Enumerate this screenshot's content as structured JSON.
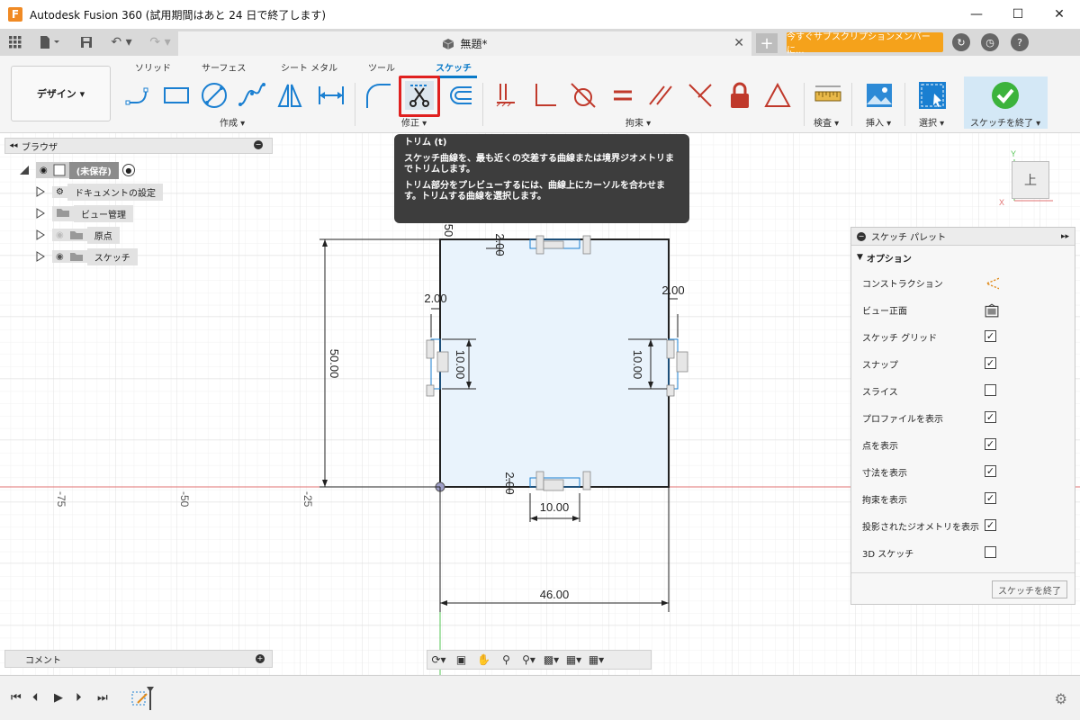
{
  "window": {
    "title": "Autodesk Fusion 360 (試用期間はあと 24 日で終了します)",
    "app_icon_letter": "F"
  },
  "tabs": {
    "document_tab": "無題*",
    "promo": "今すぐサブスクリプションメンバーに..."
  },
  "workspace": {
    "label": "デザイン ▾"
  },
  "ribbon_tabs": [
    "ソリッド",
    "サーフェス",
    "シート メタル",
    "ツール",
    "スケッチ"
  ],
  "active_tab": "スケッチ",
  "ribbon_groups": {
    "create": "作成 ▾",
    "modify": "修正 ▾",
    "constraints": "拘束 ▾",
    "inspect": "検査 ▾",
    "insert": "挿入 ▾",
    "select": "選択 ▾",
    "finish": "スケッチを終了 ▾"
  },
  "browser": {
    "title": "ブラウザ",
    "root": "(未保存)",
    "items": [
      "ドキュメントの設定",
      "ビュー管理",
      "原点",
      "スケッチ"
    ]
  },
  "tooltip": {
    "title": "トリム (t)",
    "line1": "スケッチ曲線を、最も近くの交差する曲線または境界ジオメトリまでトリムします。",
    "line2": "トリム部分をプレビューするには、曲線上にカーソルを合わせます。トリムする曲線を選択します。"
  },
  "viewcube": {
    "face": "上",
    "axis_x": "X",
    "axis_y": "Y"
  },
  "palette": {
    "title": "スケッチ パレット",
    "section": "オプション",
    "options": [
      {
        "label": "コンストラクション",
        "type": "icon"
      },
      {
        "label": "ビュー正面",
        "type": "icon"
      },
      {
        "label": "スケッチ グリッド",
        "type": "check",
        "checked": true
      },
      {
        "label": "スナップ",
        "type": "check",
        "checked": true
      },
      {
        "label": "スライス",
        "type": "check",
        "checked": false
      },
      {
        "label": "プロファイルを表示",
        "type": "check",
        "checked": true
      },
      {
        "label": "点を表示",
        "type": "check",
        "checked": true
      },
      {
        "label": "寸法を表示",
        "type": "check",
        "checked": true
      },
      {
        "label": "拘束を表示",
        "type": "check",
        "checked": true
      },
      {
        "label": "投影されたジオメトリを表示",
        "type": "check",
        "checked": true
      },
      {
        "label": "3D スケッチ",
        "type": "check",
        "checked": false
      }
    ],
    "finish_button": "スケッチを終了"
  },
  "comment_bar": "コメント",
  "sketch": {
    "dimensions": {
      "width": "46.00",
      "height": "50.00",
      "slot_top": "2.00",
      "slot_bottom": "2.00",
      "slot_left": "2.00",
      "slot_right": "2.00",
      "slot_left_len": "10.00",
      "slot_right_len": "10.00",
      "slot_bottom_len": "10.00",
      "top_partial": "50"
    },
    "axis_ticks": [
      "-75",
      "-50",
      "-25"
    ]
  }
}
